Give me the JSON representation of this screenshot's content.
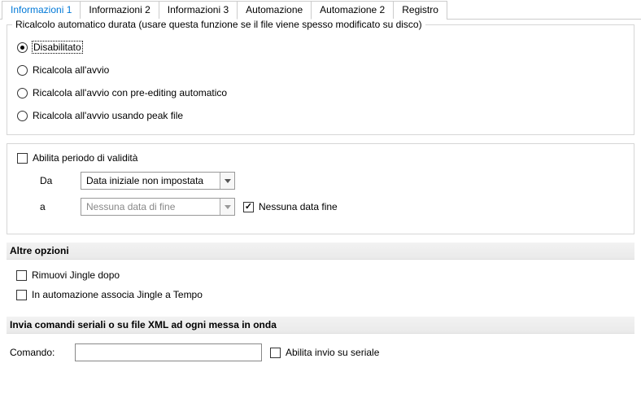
{
  "tabs": {
    "items": [
      {
        "label": "Informazioni 1",
        "active": false,
        "highlight": true
      },
      {
        "label": "Informazioni 2",
        "active": false,
        "highlight": false
      },
      {
        "label": "Informazioni 3",
        "active": false,
        "highlight": false
      },
      {
        "label": "Automazione",
        "active": true,
        "highlight": false
      },
      {
        "label": "Automazione 2",
        "active": false,
        "highlight": false
      },
      {
        "label": "Registro",
        "active": false,
        "highlight": false
      }
    ]
  },
  "recalc": {
    "legend": "Ricalcolo automatico durata (usare questa funzione se il file viene spesso modificato su disco)",
    "options": {
      "disabled": "Disabilitato",
      "onstart": "Ricalcola all'avvio",
      "onstart_pre": "Ricalcola all'avvio con pre-editing automatico",
      "onstart_peak": "Ricalcola all'avvio usando peak file"
    },
    "selected": "disabled"
  },
  "validity": {
    "enable_label": "Abilita periodo di validità",
    "enabled": false,
    "from_label": "Da",
    "from_value": "Data iniziale non impostata",
    "to_label": "a",
    "to_value": "Nessuna data di fine",
    "no_end_label": "Nessuna data fine",
    "no_end_checked": true
  },
  "other": {
    "header": "Altre opzioni",
    "remove_jingle_label": "Rimuovi Jingle dopo",
    "remove_jingle_checked": false,
    "assoc_label": "In automazione associa Jingle a Tempo",
    "assoc_checked": false
  },
  "serial": {
    "header": "Invia comandi seriali o su file XML ad ogni messa in onda",
    "label": "Comando:",
    "value": "",
    "enable_label": "Abilita invio su seriale",
    "enable_checked": false
  }
}
